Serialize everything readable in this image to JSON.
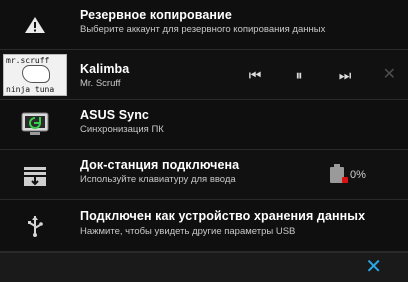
{
  "notifications": [
    {
      "id": "backup",
      "title": "Резервное копирование",
      "subtitle": "Выберите аккаунт для резервного копирования данных",
      "icon": "warning-triangle-icon"
    },
    {
      "id": "media",
      "title": "Kalimba",
      "subtitle": "Mr. Scruff",
      "thumbnail_text_top": "mr.scruff",
      "thumbnail_text_bottom": "ninja tuna",
      "controls": {
        "prev": "⏮",
        "pause": "⏸",
        "next": "⏭",
        "close": "✕"
      }
    },
    {
      "id": "asus-sync",
      "title": "ASUS Sync",
      "subtitle": "Синхронизация ПК",
      "icon": "sync-icon"
    },
    {
      "id": "dock",
      "title": "Док-станция подключена",
      "subtitle": "Используйте клавиатуру для ввода",
      "icon": "dock-icon",
      "battery_text": "0%"
    },
    {
      "id": "usb",
      "title": "Подключен как устройство хранения данных",
      "subtitle": "Нажмите, чтобы увидеть другие параметры USB",
      "icon": "usb-icon"
    }
  ],
  "bottom_bar": {
    "dismiss_all": "✕"
  },
  "colors": {
    "accent": "#2aa7e6",
    "background": "#0b0b0b"
  }
}
